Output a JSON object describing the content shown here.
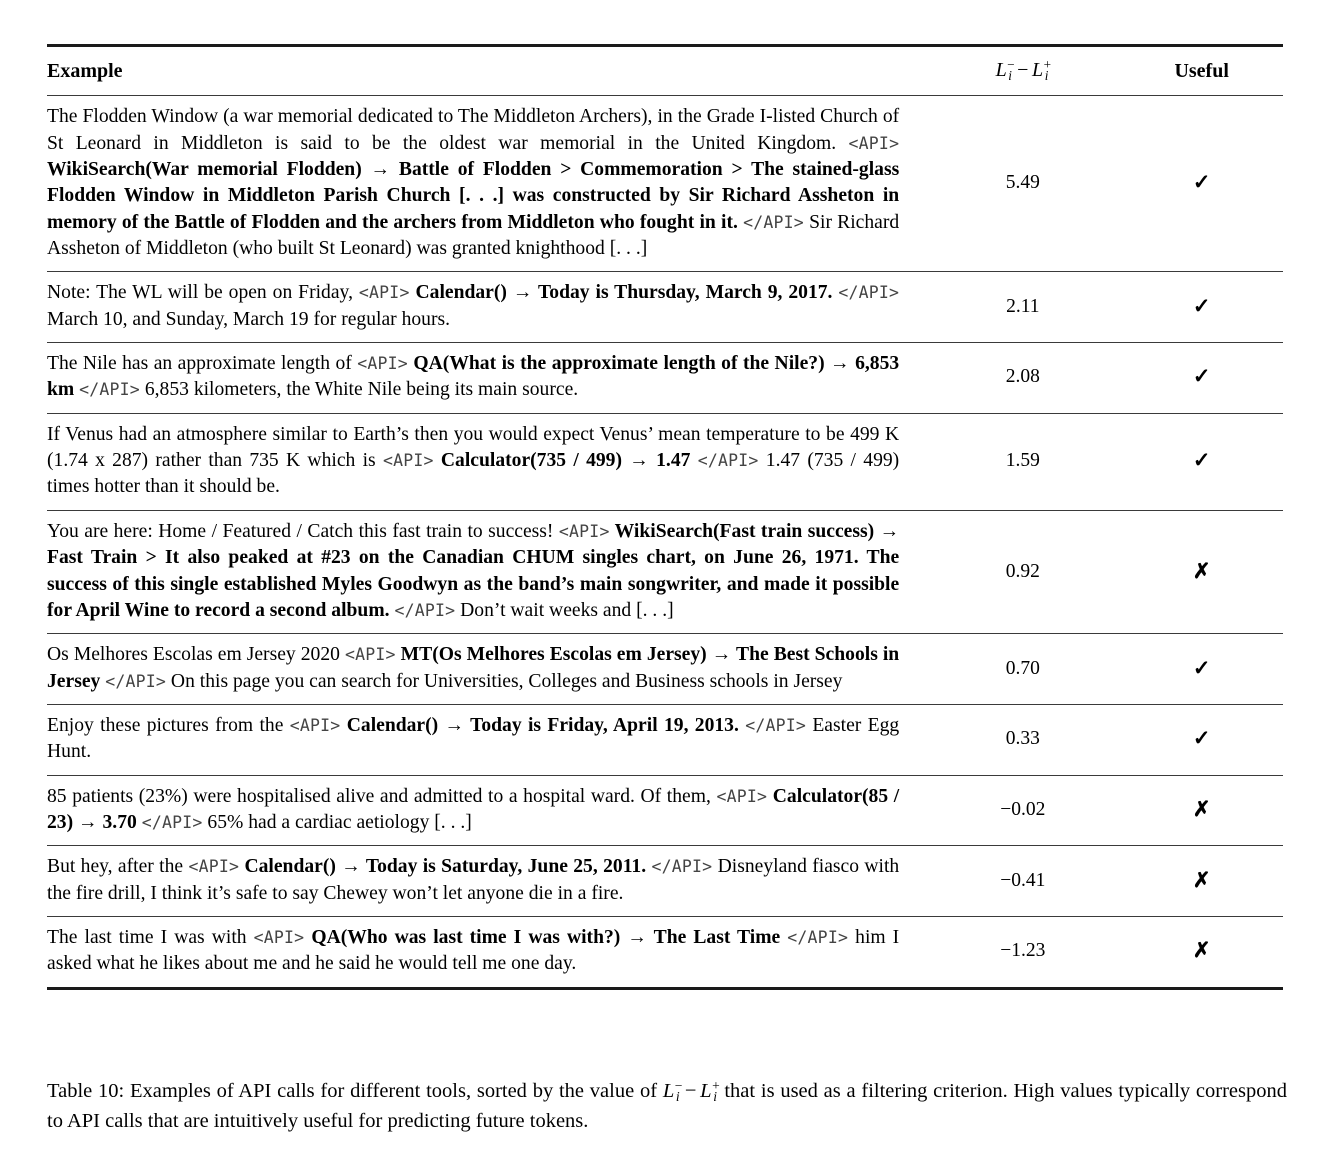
{
  "table": {
    "columns": {
      "example": "Example",
      "score_math": {
        "base": "L",
        "sub": "i",
        "sup_left": "−",
        "sup_right": "+",
        "op": "−"
      },
      "useful": "Useful"
    },
    "marks": {
      "yes": "✓",
      "no": "✗"
    },
    "rows": [
      {
        "id": "row-flodden",
        "segments": [
          {
            "type": "text",
            "value": "The Flodden Window (a war memorial dedicated to The Middleton Archers), in the Grade I-listed Church of St Leonard in Middleton is said to be the oldest war memorial in the United King­dom. "
          },
          {
            "type": "api-open",
            "value": "<API>"
          },
          {
            "type": "call",
            "value": " WikiSearch(War memorial Flodden) → Battle of Flodden > Commemoration > The stained-glass Flodden Window in Middleton Parish Church [. . .] was constructed by Sir Richard Assheton in memory of the Battle of Flodden and the archers from Middleton who fought in it. "
          },
          {
            "type": "api-close",
            "value": "</API>"
          },
          {
            "type": "text",
            "value": " Sir Richard Assheton of Middleton (who built St Leonard) was granted knighthood [. . .]"
          }
        ],
        "score": "5.49",
        "useful": "yes"
      },
      {
        "id": "row-calendar-2017",
        "segments": [
          {
            "type": "text",
            "value": "Note: The WL will be open on Friday, "
          },
          {
            "type": "api-open",
            "value": "<API>"
          },
          {
            "type": "call",
            "value": " Calendar() → Today is Thursday, March 9, 2017. "
          },
          {
            "type": "api-close",
            "value": "</API>"
          },
          {
            "type": "text",
            "value": " March 10, and Sunday, March 19 for regular hours."
          }
        ],
        "score": "2.11",
        "useful": "yes"
      },
      {
        "id": "row-nile",
        "segments": [
          {
            "type": "text",
            "value": "The Nile has an approximate length of "
          },
          {
            "type": "api-open",
            "value": "<API>"
          },
          {
            "type": "call",
            "value": " QA(What is the approximate length of the Nile?) → 6,853 km "
          },
          {
            "type": "api-close",
            "value": "</API>"
          },
          {
            "type": "text",
            "value": " 6,853 kilometers, the White Nile being its main source."
          }
        ],
        "score": "2.08",
        "useful": "yes"
      },
      {
        "id": "row-venus",
        "segments": [
          {
            "type": "text",
            "value": "If Venus had an atmosphere similar to Earth’s then you would expect Venus’ mean temperature to be 499 K (1.74 x 287) rather than 735 K which is "
          },
          {
            "type": "api-open",
            "value": "<API>"
          },
          {
            "type": "call",
            "value": " Calculator(735 / 499) → 1.47 "
          },
          {
            "type": "api-close",
            "value": "</API>"
          },
          {
            "type": "text",
            "value": " 1.47 (735 / 499) times hotter than it should be."
          }
        ],
        "score": "1.59",
        "useful": "yes"
      },
      {
        "id": "row-fast-train",
        "segments": [
          {
            "type": "text",
            "value": "You are here: Home / Featured / Catch this fast train to success! "
          },
          {
            "type": "api-open",
            "value": "<API>"
          },
          {
            "type": "call",
            "value": " WikiSearch(Fast train success) → Fast Train > It also peaked at #23 on the Canadian CHUM singles chart, on June 26, 1971. The success of this single established Myles Goodwyn as the band’s main songwriter, and made it possible for April Wine to record a second album. "
          },
          {
            "type": "api-close",
            "value": "</API>"
          },
          {
            "type": "text",
            "value": " Don’t wait weeks and [. . .]"
          }
        ],
        "score": "0.92",
        "useful": "no"
      },
      {
        "id": "row-jersey",
        "segments": [
          {
            "type": "text",
            "value": "Os Melhores Escolas em Jersey 2020 "
          },
          {
            "type": "api-open",
            "value": "<API>"
          },
          {
            "type": "call",
            "value": " MT(Os Melhores Escolas em Jersey) → The Best Schools in Jersey "
          },
          {
            "type": "api-close",
            "value": "</API>"
          },
          {
            "type": "text",
            "value": " On this page you can search for Universities, Colleges and Business schools in Jersey"
          }
        ],
        "score": "0.70",
        "useful": "yes"
      },
      {
        "id": "row-calendar-2013",
        "segments": [
          {
            "type": "text",
            "value": "Enjoy these pictures from the "
          },
          {
            "type": "api-open",
            "value": "<API>"
          },
          {
            "type": "call",
            "value": " Calendar() → Today is Friday, April 19, 2013. "
          },
          {
            "type": "api-close",
            "value": "</API>"
          },
          {
            "type": "text",
            "value": " Easter Egg Hunt."
          }
        ],
        "score": "0.33",
        "useful": "yes"
      },
      {
        "id": "row-patients",
        "segments": [
          {
            "type": "text",
            "value": "85 patients (23%) were hospitalised alive and admitted to a hospital ward. Of them, "
          },
          {
            "type": "api-open",
            "value": "<API>"
          },
          {
            "type": "call",
            "value": " Calcula­tor(85 / 23) → 3.70 "
          },
          {
            "type": "api-close",
            "value": "</API>"
          },
          {
            "type": "text",
            "value": " 65% had a cardiac aetiology [. . .]"
          }
        ],
        "score": "−0.02",
        "useful": "no"
      },
      {
        "id": "row-disneyland",
        "segments": [
          {
            "type": "text",
            "value": "But hey, after the "
          },
          {
            "type": "api-open",
            "value": "<API>"
          },
          {
            "type": "call",
            "value": " Calendar() → Today is Saturday, June 25, 2011. "
          },
          {
            "type": "api-close",
            "value": "</API>"
          },
          {
            "type": "text",
            "value": " Disneyland fiasco with the fire drill, I think it’s safe to say Chewey won’t let anyone die in a fire."
          }
        ],
        "score": "−0.41",
        "useful": "no"
      },
      {
        "id": "row-last-time",
        "segments": [
          {
            "type": "text",
            "value": "The last time I was with "
          },
          {
            "type": "api-open",
            "value": "<API>"
          },
          {
            "type": "call",
            "value": " QA(Who was last time I was with?) → The Last Time "
          },
          {
            "type": "api-close",
            "value": "</API>"
          },
          {
            "type": "text",
            "value": " him I asked what he likes about me and he said he would tell me one day."
          }
        ],
        "score": "−1.23",
        "useful": "no"
      }
    ]
  },
  "caption": {
    "label": "Table 10:",
    "part1": " Examples of API calls for different tools, sorted by the value of ",
    "part2": " that is used as a filtering criterion. High values typically correspond to API calls that are intuitively useful for predicting future tokens."
  }
}
